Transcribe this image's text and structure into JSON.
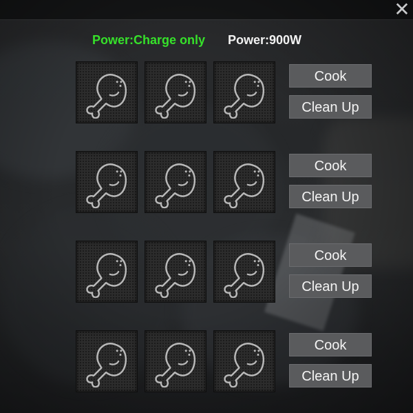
{
  "header": {
    "power_mode": "Power:Charge only",
    "power_watt": "Power:900W",
    "power_mode_color": "#36e12a"
  },
  "close_icon": "close-icon",
  "slot_icon": "drumstick-icon",
  "groups": [
    {
      "cook_label": "Cook",
      "clean_label": "Clean Up"
    },
    {
      "cook_label": "Cook",
      "clean_label": "Clean Up"
    },
    {
      "cook_label": "Cook",
      "clean_label": "Clean Up"
    },
    {
      "cook_label": "Cook",
      "clean_label": "Clean Up"
    }
  ]
}
